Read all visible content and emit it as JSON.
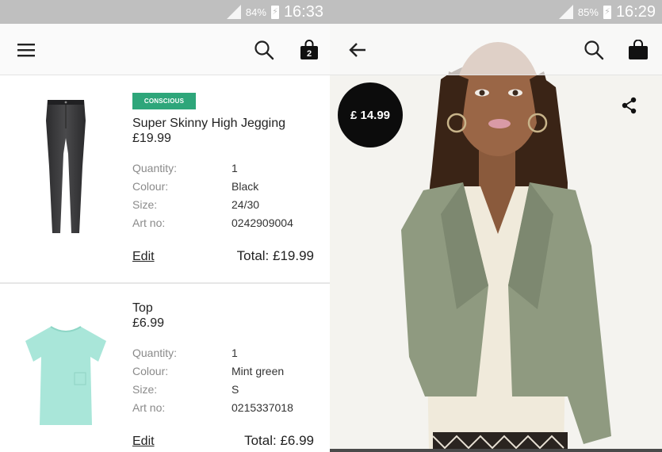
{
  "left_screen": {
    "status_bar": {
      "battery_percent": "84%",
      "time": "16:33"
    },
    "app_bar": {
      "menu_icon": "hamburger-menu-icon",
      "search_icon": "search-icon",
      "bag_icon": "shopping-bag-icon",
      "bag_count": "2"
    },
    "cart_items": [
      {
        "badge": "CONSCIOUS",
        "name": "Super Skinny High Jegging",
        "price": "£19.99",
        "labels": {
          "quantity": "Quantity:",
          "colour": "Colour:",
          "size": "Size:",
          "art_no": "Art no:"
        },
        "values": {
          "quantity": "1",
          "colour": "Black",
          "size": "24/30",
          "art_no": "0242909004"
        },
        "edit_label": "Edit",
        "total": "Total: £19.99"
      },
      {
        "name": "Top",
        "price": "£6.99",
        "labels": {
          "quantity": "Quantity:",
          "colour": "Colour:",
          "size": "Size:",
          "art_no": "Art no:"
        },
        "values": {
          "quantity": "1",
          "colour": "Mint green",
          "size": "S",
          "art_no": "0215337018"
        },
        "edit_label": "Edit",
        "total": "Total: £6.99"
      }
    ]
  },
  "right_screen": {
    "status_bar": {
      "battery_percent": "85%",
      "time": "16:29"
    },
    "app_bar": {
      "back_icon": "arrow-back-icon",
      "search_icon": "search-icon",
      "bag_icon": "shopping-bag-icon"
    },
    "product": {
      "price": "£ 14.99",
      "share_icon": "share-icon"
    }
  },
  "colors": {
    "status_bar": "#bfbfbf",
    "conscious_badge": "#2ea67a",
    "price_circle": "#0c0c0c",
    "jacket": "#8f9a80"
  }
}
